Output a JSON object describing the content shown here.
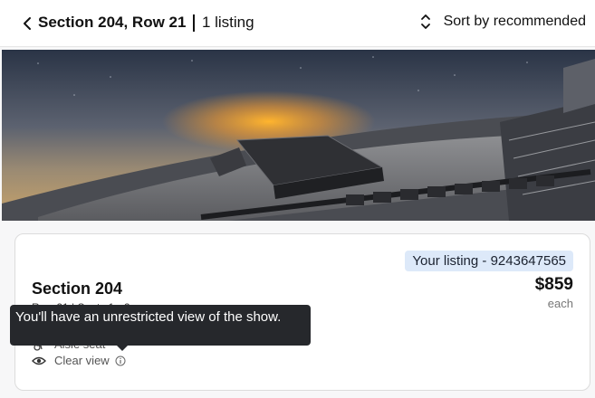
{
  "header": {
    "back_icon": "chevron-left-icon",
    "title": "Section 204, Row 21",
    "listing_count": "1 listing",
    "sort_icon": "sort-updown-icon",
    "sort_label": "Sort by recommended"
  },
  "view_image": {
    "description": "seat view"
  },
  "listing": {
    "badge": "Your listing - 9243647565",
    "section": "Section 204",
    "row_seat": "Row 21 | Seats 1 - 2",
    "price": "$859",
    "price_unit": "each",
    "features": [
      {
        "icon": "wheelchair-icon",
        "label": "Aisle seat"
      },
      {
        "icon": "eye-icon",
        "label": "Clear view",
        "info_icon": "info-icon"
      }
    ]
  },
  "tooltip": {
    "text": "You'll have an unrestricted view of the show."
  },
  "colors": {
    "badge_bg": "#dde9f9",
    "tooltip_bg": "#26282c"
  }
}
